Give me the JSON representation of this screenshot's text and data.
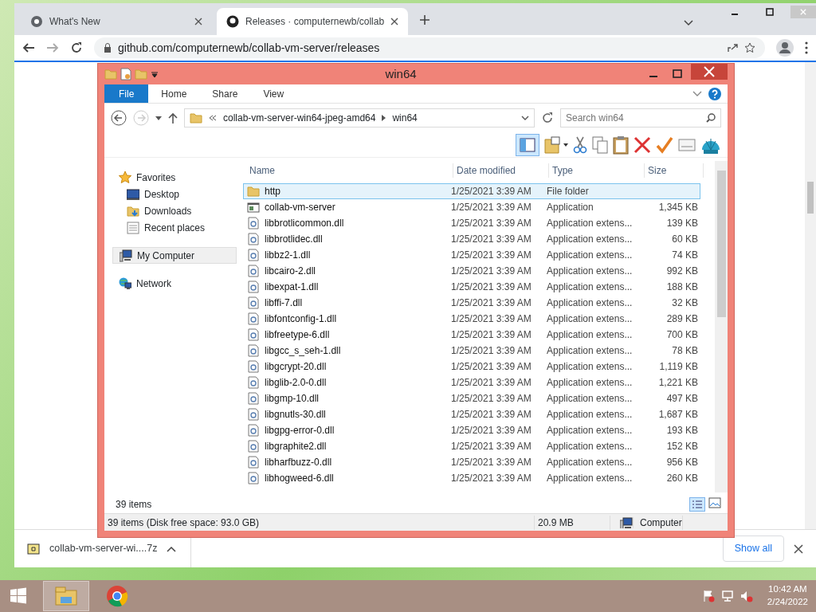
{
  "browser": {
    "tabs": [
      {
        "title": "What's New",
        "selected": false
      },
      {
        "title": "Releases · computernewb/collab",
        "selected": true
      }
    ],
    "address": "github.com/computernewb/collab-vm-server/releases"
  },
  "explorer": {
    "title": "win64",
    "ribbon_tabs": [
      {
        "label": "File",
        "selected": true
      },
      {
        "label": "Home",
        "selected": false
      },
      {
        "label": "Share",
        "selected": false
      },
      {
        "label": "View",
        "selected": false
      }
    ],
    "breadcrumb": [
      "collab-vm-server-win64-jpeg-amd64",
      "win64"
    ],
    "search": {
      "placeholder": "Search win64"
    },
    "nav": [
      {
        "label": "Favorites",
        "kind": "favorites",
        "selected": false,
        "children": [
          {
            "label": "Desktop",
            "kind": "desktop",
            "selected": false
          },
          {
            "label": "Downloads",
            "kind": "downloads",
            "selected": false
          },
          {
            "label": "Recent places",
            "kind": "recent",
            "selected": false
          }
        ]
      },
      {
        "label": "My Computer",
        "kind": "computer",
        "selected": true
      },
      {
        "label": "Network",
        "kind": "network",
        "selected": false
      }
    ],
    "columns": [
      "Name",
      "Date modified",
      "Type",
      "Size"
    ],
    "rows": [
      {
        "name": "http",
        "date": "1/25/2021 3:39 AM",
        "type": "File folder",
        "size": "",
        "kind": "folder",
        "selected": true
      },
      {
        "name": "collab-vm-server",
        "date": "1/25/2021 3:39 AM",
        "type": "Application",
        "size": "1,345 KB",
        "kind": "app",
        "selected": false
      },
      {
        "name": "libbrotlicommon.dll",
        "date": "1/25/2021 3:39 AM",
        "type": "Application extens...",
        "size": "139 KB",
        "kind": "dll",
        "selected": false
      },
      {
        "name": "libbrotlidec.dll",
        "date": "1/25/2021 3:39 AM",
        "type": "Application extens...",
        "size": "60 KB",
        "kind": "dll",
        "selected": false
      },
      {
        "name": "libbz2-1.dll",
        "date": "1/25/2021 3:39 AM",
        "type": "Application extens...",
        "size": "74 KB",
        "kind": "dll",
        "selected": false
      },
      {
        "name": "libcairo-2.dll",
        "date": "1/25/2021 3:39 AM",
        "type": "Application extens...",
        "size": "992 KB",
        "kind": "dll",
        "selected": false
      },
      {
        "name": "libexpat-1.dll",
        "date": "1/25/2021 3:39 AM",
        "type": "Application extens...",
        "size": "188 KB",
        "kind": "dll",
        "selected": false
      },
      {
        "name": "libffi-7.dll",
        "date": "1/25/2021 3:39 AM",
        "type": "Application extens...",
        "size": "32 KB",
        "kind": "dll",
        "selected": false
      },
      {
        "name": "libfontconfig-1.dll",
        "date": "1/25/2021 3:39 AM",
        "type": "Application extens...",
        "size": "289 KB",
        "kind": "dll",
        "selected": false
      },
      {
        "name": "libfreetype-6.dll",
        "date": "1/25/2021 3:39 AM",
        "type": "Application extens...",
        "size": "700 KB",
        "kind": "dll",
        "selected": false
      },
      {
        "name": "libgcc_s_seh-1.dll",
        "date": "1/25/2021 3:39 AM",
        "type": "Application extens...",
        "size": "78 KB",
        "kind": "dll",
        "selected": false
      },
      {
        "name": "libgcrypt-20.dll",
        "date": "1/25/2021 3:39 AM",
        "type": "Application extens...",
        "size": "1,119 KB",
        "kind": "dll",
        "selected": false
      },
      {
        "name": "libglib-2.0-0.dll",
        "date": "1/25/2021 3:39 AM",
        "type": "Application extens...",
        "size": "1,221 KB",
        "kind": "dll",
        "selected": false
      },
      {
        "name": "libgmp-10.dll",
        "date": "1/25/2021 3:39 AM",
        "type": "Application extens...",
        "size": "497 KB",
        "kind": "dll",
        "selected": false
      },
      {
        "name": "libgnutls-30.dll",
        "date": "1/25/2021 3:39 AM",
        "type": "Application extens...",
        "size": "1,687 KB",
        "kind": "dll",
        "selected": false
      },
      {
        "name": "libgpg-error-0.dll",
        "date": "1/25/2021 3:39 AM",
        "type": "Application extens...",
        "size": "193 KB",
        "kind": "dll",
        "selected": false
      },
      {
        "name": "libgraphite2.dll",
        "date": "1/25/2021 3:39 AM",
        "type": "Application extens...",
        "size": "152 KB",
        "kind": "dll",
        "selected": false
      },
      {
        "name": "libharfbuzz-0.dll",
        "date": "1/25/2021 3:39 AM",
        "type": "Application extens...",
        "size": "956 KB",
        "kind": "dll",
        "selected": false
      },
      {
        "name": "libhogweed-6.dll",
        "date": "1/25/2021 3:39 AM",
        "type": "Application extens...",
        "size": "260 KB",
        "kind": "dll",
        "selected": false
      }
    ],
    "item_count": "39 items",
    "status_bar": {
      "summary": "39 items (Disk free space: 93.0 GB)",
      "size": "20.9 MB",
      "location": "Computer"
    }
  },
  "download_bar": {
    "file": "collab-vm-server-wi....7z",
    "show_all": "Show all"
  },
  "taskbar": {
    "time": "10:42 AM",
    "date": "2/24/2022"
  }
}
